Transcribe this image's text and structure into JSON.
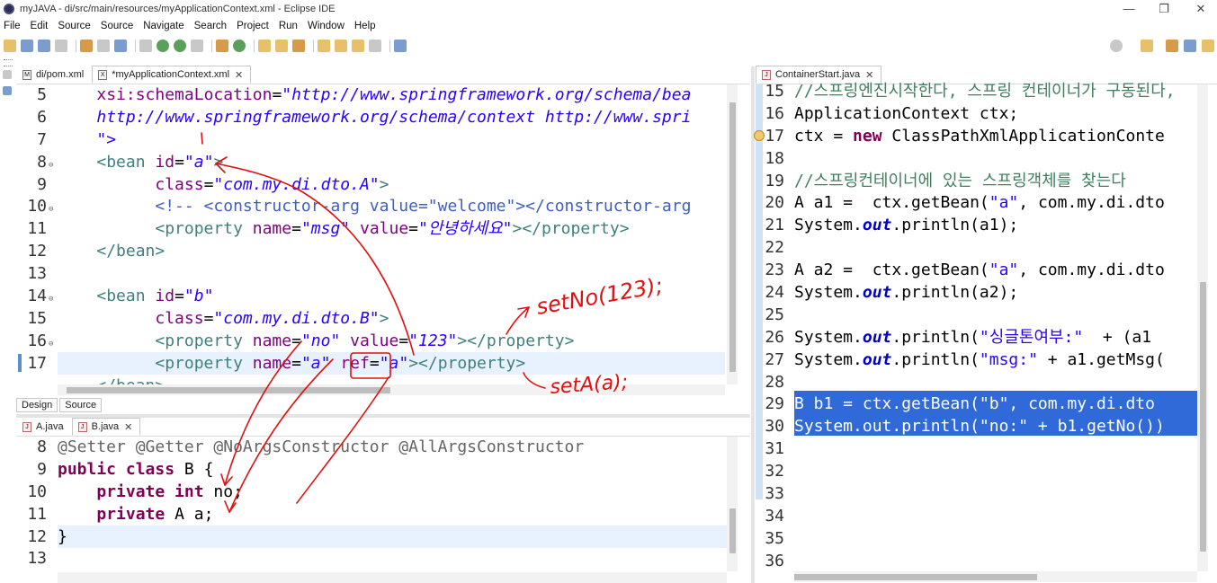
{
  "window": {
    "title": "myJAVA - di/src/main/resources/myApplicationContext.xml - Eclipse IDE",
    "controls": [
      "—",
      "❐",
      "✕"
    ]
  },
  "menu": [
    "File",
    "Edit",
    "Source",
    "Source",
    "Navigate",
    "Search",
    "Project",
    "Run",
    "Window",
    "Help"
  ],
  "xml_editor": {
    "tabs": [
      {
        "label": "di/pom.xml",
        "icon": "M"
      },
      {
        "label": "*myApplicationContext.xml",
        "icon": "X",
        "close": "✕"
      }
    ],
    "lines": [
      {
        "n": "5",
        "fold": "",
        "segs": [
          [
            "    ",
            ""
          ],
          [
            "xsi:schemaLocation",
            "attr"
          ],
          [
            "=",
            ""
          ],
          [
            "\"http://www.springframework.org/schema/bea",
            "str"
          ]
        ]
      },
      {
        "n": "6",
        "fold": "",
        "segs": [
          [
            "    ",
            ""
          ],
          [
            "http://www.springframework.org/schema/context http://www.spri",
            "str"
          ]
        ]
      },
      {
        "n": "7",
        "fold": "",
        "segs": [
          [
            "    ",
            ""
          ],
          [
            "\">",
            "str"
          ]
        ]
      },
      {
        "n": "8",
        "fold": "⊖",
        "segs": [
          [
            "    ",
            ""
          ],
          [
            "<bean ",
            "tag"
          ],
          [
            "id",
            "attr"
          ],
          [
            "=",
            ""
          ],
          [
            "\"a\"",
            "str"
          ],
          [
            ">",
            "tag"
          ]
        ]
      },
      {
        "n": "9",
        "fold": "",
        "segs": [
          [
            "          ",
            ""
          ],
          [
            "class",
            "attr"
          ],
          [
            "=",
            ""
          ],
          [
            "\"com.my.di.dto.A\"",
            "str"
          ],
          [
            ">",
            "tag"
          ]
        ]
      },
      {
        "n": "10",
        "fold": "⊖",
        "segs": [
          [
            "          ",
            ""
          ],
          [
            "<!-- <constructor-arg value=\"welcome\"></constructor-arg",
            "com"
          ]
        ]
      },
      {
        "n": "11",
        "fold": "",
        "segs": [
          [
            "          ",
            ""
          ],
          [
            "<property ",
            "tag"
          ],
          [
            "name",
            "attr"
          ],
          [
            "=",
            ""
          ],
          [
            "\"msg\"",
            "str"
          ],
          [
            " ",
            ""
          ],
          [
            "value",
            "attr"
          ],
          [
            "=",
            ""
          ],
          [
            "\"안녕하세요\"",
            "str"
          ],
          [
            "></property>",
            "tag"
          ]
        ]
      },
      {
        "n": "12",
        "fold": "",
        "segs": [
          [
            "    ",
            ""
          ],
          [
            "</bean>",
            "tag"
          ]
        ]
      },
      {
        "n": "13",
        "fold": "",
        "segs": [
          [
            "",
            ""
          ]
        ]
      },
      {
        "n": "14",
        "fold": "⊖",
        "segs": [
          [
            "    ",
            ""
          ],
          [
            "<bean ",
            "tag"
          ],
          [
            "id",
            "attr"
          ],
          [
            "=",
            ""
          ],
          [
            "\"b\"",
            "str"
          ]
        ]
      },
      {
        "n": "15",
        "fold": "",
        "segs": [
          [
            "          ",
            ""
          ],
          [
            "class",
            "attr"
          ],
          [
            "=",
            ""
          ],
          [
            "\"com.my.di.dto.B\"",
            "str"
          ],
          [
            ">",
            "tag"
          ]
        ]
      },
      {
        "n": "16",
        "fold": "⊖",
        "segs": [
          [
            "          ",
            ""
          ],
          [
            "<property ",
            "tag"
          ],
          [
            "name",
            "attr"
          ],
          [
            "=",
            ""
          ],
          [
            "\"no\"",
            "str"
          ],
          [
            " ",
            ""
          ],
          [
            "value",
            "attr"
          ],
          [
            "=",
            ""
          ],
          [
            "\"123\"",
            "str"
          ],
          [
            "></property>",
            "tag"
          ]
        ]
      },
      {
        "n": "17",
        "fold": "",
        "segs": [
          [
            "          ",
            ""
          ],
          [
            "<property ",
            "tag"
          ],
          [
            "name",
            "attr"
          ],
          [
            "=",
            ""
          ],
          [
            "\"a\"",
            "str"
          ],
          [
            " ",
            ""
          ],
          [
            "ref",
            "attr"
          ],
          [
            "=",
            ""
          ],
          [
            "\"a\"",
            "str"
          ],
          [
            "></property>",
            "tag"
          ]
        ]
      },
      {
        "n": "",
        "fold": "",
        "segs": [
          [
            "    ",
            ""
          ],
          [
            "</bean>",
            "tag"
          ]
        ]
      }
    ],
    "bottom_tabs": [
      "Design",
      "Source"
    ]
  },
  "java_editor": {
    "tabs": [
      {
        "label": "A.java",
        "icon": "J"
      },
      {
        "label": "B.java",
        "icon": "J",
        "close": "✕"
      }
    ],
    "lines": [
      {
        "n": "8",
        "segs": [
          [
            "@Setter @Getter @NoArgsConstructor @AllArgsConstructor",
            "ann"
          ]
        ]
      },
      {
        "n": "9",
        "segs": [
          [
            "public class ",
            "kw"
          ],
          [
            "B {",
            ""
          ]
        ]
      },
      {
        "n": "10",
        "segs": [
          [
            "    ",
            ""
          ],
          [
            "private int ",
            "kw"
          ],
          [
            "no",
            ""
          ],
          [
            ";",
            ""
          ]
        ]
      },
      {
        "n": "11",
        "segs": [
          [
            "    ",
            ""
          ],
          [
            "private ",
            "kw"
          ],
          [
            "A a;",
            ""
          ]
        ]
      },
      {
        "n": "12",
        "segs": [
          [
            "}",
            ""
          ]
        ]
      },
      {
        "n": "13",
        "segs": [
          [
            "",
            ""
          ]
        ]
      }
    ]
  },
  "main_editor": {
    "tabs": [
      {
        "label": "ContainerStart.java",
        "icon": "J",
        "close": "✕"
      }
    ],
    "lines": [
      {
        "n": "15",
        "segs": [
          [
            "//스프링엔진시작한다, 스프링 컨테이너가 구동된다,",
            "jcom"
          ]
        ]
      },
      {
        "n": "16",
        "segs": [
          [
            "ApplicationContext ctx;",
            ""
          ]
        ]
      },
      {
        "n": "17",
        "segs": [
          [
            "ctx = ",
            ""
          ],
          [
            "new ",
            "kw"
          ],
          [
            "ClassPathXmlApplicationConte",
            ""
          ]
        ]
      },
      {
        "n": "18",
        "segs": [
          [
            "",
            ""
          ]
        ]
      },
      {
        "n": "19",
        "segs": [
          [
            "//스프링컨테이너에 있는 스프링객체를 찾는다",
            "jcom"
          ]
        ]
      },
      {
        "n": "20",
        "segs": [
          [
            "A a1 =  ctx.getBean(",
            ""
          ],
          [
            "\"a\"",
            "jstr"
          ],
          [
            ", com.my.di.dto",
            ""
          ]
        ]
      },
      {
        "n": "21",
        "segs": [
          [
            "System.",
            ""
          ],
          [
            "out",
            "fld"
          ],
          [
            ".println(a1);",
            ""
          ]
        ]
      },
      {
        "n": "22",
        "segs": [
          [
            "",
            ""
          ]
        ]
      },
      {
        "n": "23",
        "segs": [
          [
            "A a2 =  ctx.getBean(",
            ""
          ],
          [
            "\"a\"",
            "jstr"
          ],
          [
            ", com.my.di.dto",
            ""
          ]
        ]
      },
      {
        "n": "24",
        "segs": [
          [
            "System.",
            ""
          ],
          [
            "out",
            "fld"
          ],
          [
            ".println(a2);",
            ""
          ]
        ]
      },
      {
        "n": "25",
        "segs": [
          [
            "",
            ""
          ]
        ]
      },
      {
        "n": "26",
        "segs": [
          [
            "System.",
            ""
          ],
          [
            "out",
            "fld"
          ],
          [
            ".println(",
            ""
          ],
          [
            "\"싱글톤여부:\"",
            "jstr"
          ],
          [
            "  + (a1",
            ""
          ]
        ]
      },
      {
        "n": "27",
        "segs": [
          [
            "System.",
            ""
          ],
          [
            "out",
            "fld"
          ],
          [
            ".println(",
            ""
          ],
          [
            "\"msg:\"",
            "jstr"
          ],
          [
            " + a1.getMsg(",
            ""
          ]
        ]
      },
      {
        "n": "28",
        "segs": [
          [
            "",
            ""
          ]
        ]
      },
      {
        "n": "29",
        "segs": [
          [
            "B b1 = ctx.getBean(\"b\", com.my.di.dto",
            "white"
          ]
        ]
      },
      {
        "n": "30",
        "segs": [
          [
            "System.",
            "white"
          ],
          [
            "out",
            "white"
          ],
          [
            ".println(\"no:\" + b1.getNo())",
            "white"
          ]
        ]
      },
      {
        "n": "31",
        "segs": [
          [
            "",
            ""
          ]
        ]
      },
      {
        "n": "32",
        "segs": [
          [
            "",
            ""
          ]
        ]
      },
      {
        "n": "33",
        "segs": [
          [
            "",
            ""
          ]
        ]
      },
      {
        "n": "34",
        "segs": [
          [
            "",
            ""
          ]
        ]
      },
      {
        "n": "35",
        "segs": [
          [
            "",
            ""
          ]
        ]
      },
      {
        "n": "36",
        "segs": [
          [
            "",
            ""
          ]
        ]
      }
    ]
  },
  "annotations": [
    "setNo(123);",
    "setA(a);"
  ],
  "colors": {
    "keyword": "#7f0055",
    "string": "#2a00ff",
    "xml_tag": "#3f7f7f",
    "xml_attr": "#7f007f",
    "selection": "#2f6ad8",
    "current_line": "#e8f2fe",
    "ink": "#e01010"
  }
}
